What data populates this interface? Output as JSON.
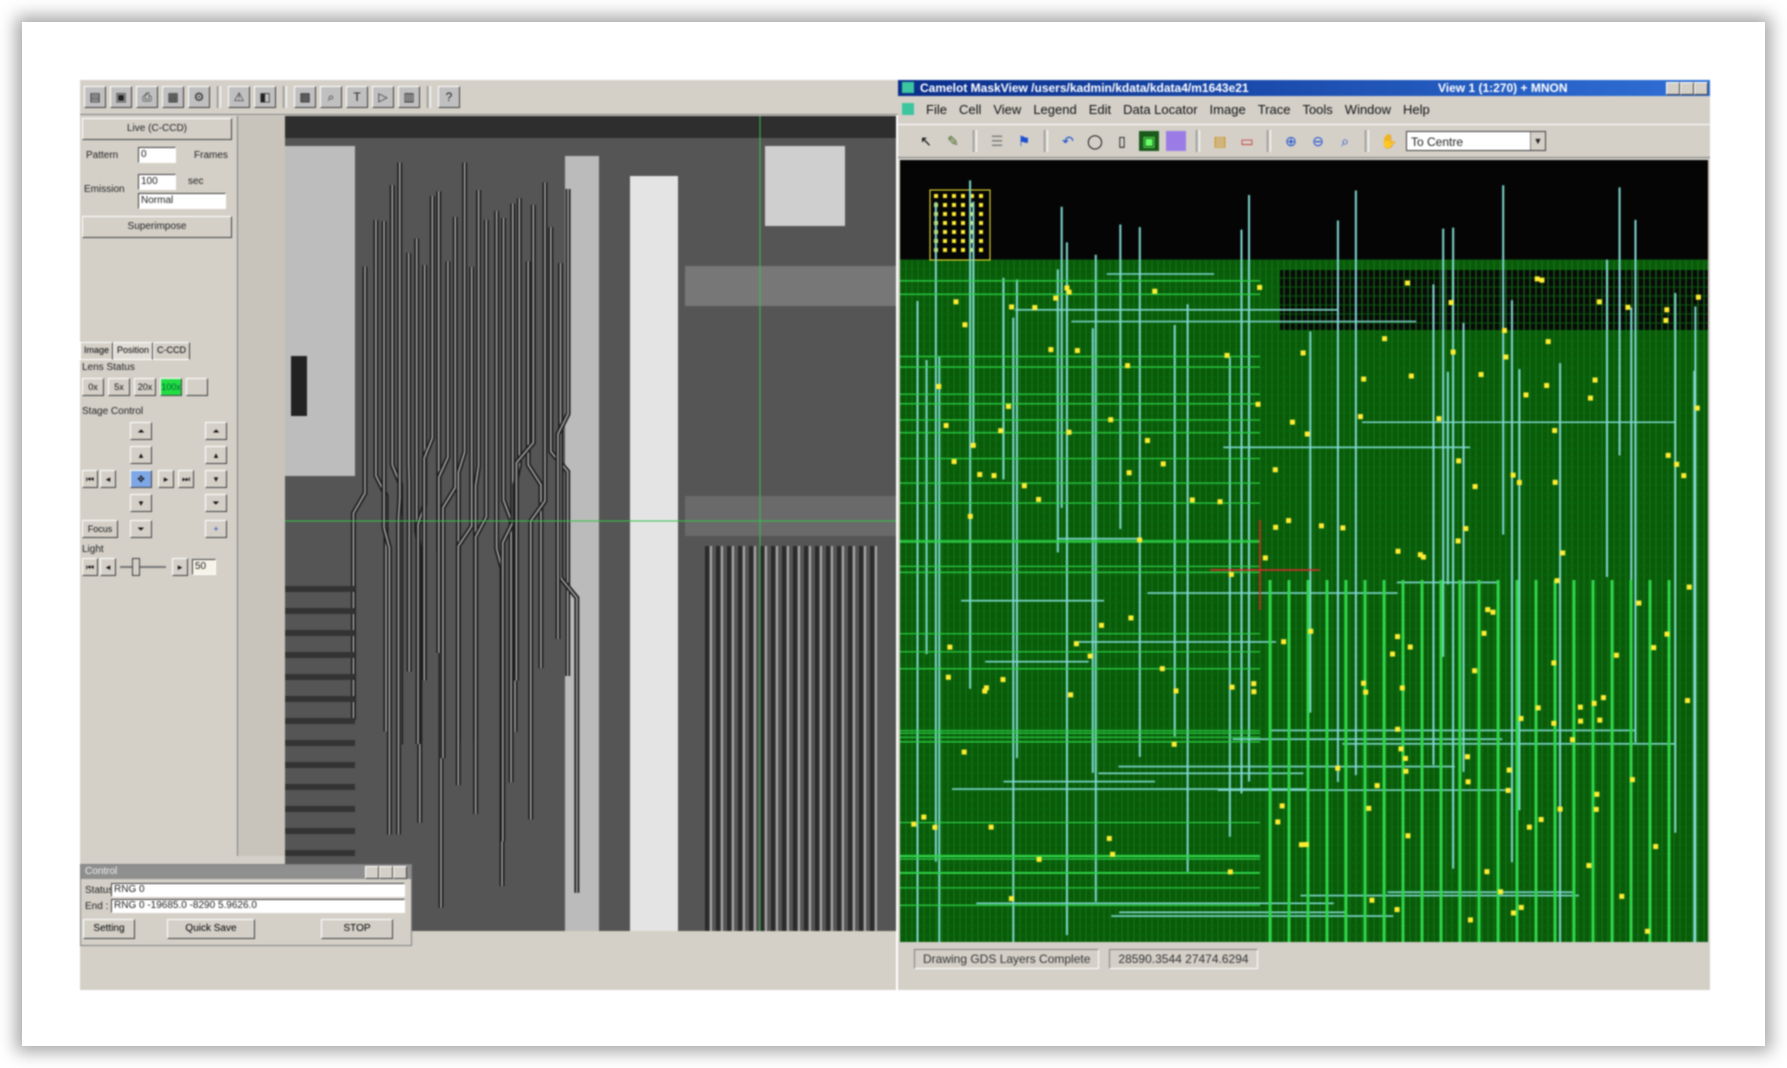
{
  "left_app": {
    "control_panel": {
      "live_button": "Live (C-CCD)",
      "pattern_label": "Pattern",
      "pattern_value": "0",
      "frames_label": "Frames",
      "emission_label": "Emission",
      "emission_value": "100",
      "emission_unit": "sec",
      "mode_value": "Normal",
      "superimpose_button": "Superimpose",
      "tabs": [
        "Image",
        "Position",
        "C-CCD"
      ],
      "lens_status_label": "Lens Status",
      "lens_buttons": [
        "0x",
        "5x",
        "20x",
        "100x"
      ],
      "stage_control_label": "Stage Control",
      "focus_label": "Focus",
      "light_label": "Light",
      "light_value": "50"
    },
    "control_dialog": {
      "title": "Control",
      "status_label": "Status :",
      "status_value": "RNG 0",
      "end_label": "End :",
      "end_value": "RNG 0 -19685.0 -8290 5.9626.0",
      "setting_button": "Setting",
      "quick_save_button": "Quick Save",
      "stop_button": "STOP"
    }
  },
  "right_app": {
    "title": "Camelot MaskView /users/kadmin/kdata/kdata4/m1643e21",
    "view_label": "View 1 (1:270) + MNON",
    "menu": [
      "File",
      "Cell",
      "View",
      "Legend",
      "Edit",
      "Data Locator",
      "Image",
      "Trace",
      "Tools",
      "Window",
      "Help"
    ],
    "toolbar_combo": "To Centre",
    "status_left": "Drawing GDS Layers Complete",
    "status_right": "28590.3544 27474.6294"
  },
  "colors": {
    "title_bar_start": "#0a2e8a",
    "title_bar_end": "#2f6fd6",
    "layout_bg": "#0a5a0a",
    "trace_green": "#2fd64a",
    "trace_cyan": "#7fd8d0",
    "via_yellow": "#ffee33",
    "panel_gray": "#d4d0c8"
  }
}
